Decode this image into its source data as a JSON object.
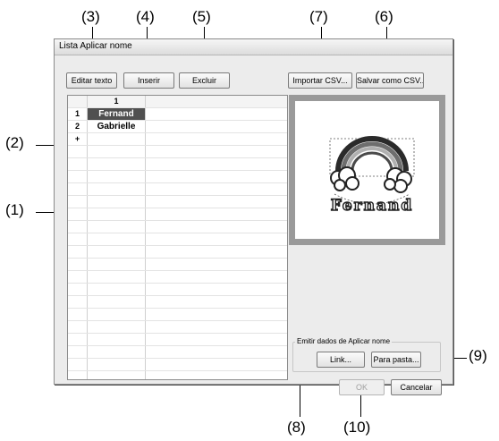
{
  "callouts": {
    "c1": "(1)",
    "c2": "(2)",
    "c3": "(3)",
    "c4": "(4)",
    "c5": "(5)",
    "c6": "(6)",
    "c7": "(7)",
    "c8": "(8)",
    "c9": "(9)",
    "c10": "(10)"
  },
  "dialog": {
    "title": "Lista Aplicar nome",
    "toolbar": {
      "edit_text": "Editar texto",
      "insert": "Inserir",
      "delete": "Excluir",
      "import_csv": "Importar CSV...",
      "save_csv": "Salvar como CSV..."
    },
    "grid": {
      "column_header": "1",
      "rows": [
        {
          "header": "1",
          "value": "Fernand",
          "selected": true
        },
        {
          "header": "2",
          "value": "Gabrielle",
          "selected": false
        },
        {
          "header": "+",
          "value": "",
          "selected": false
        }
      ]
    },
    "preview": {
      "embroidery_text": "Fernand",
      "frame_color": "#9a9a9a"
    },
    "output_group": {
      "label": "Emitir dados de Aplicar nome",
      "link": "Link...",
      "to_folder": "Para pasta..."
    },
    "footer": {
      "ok": "OK",
      "cancel": "Cancelar"
    }
  }
}
